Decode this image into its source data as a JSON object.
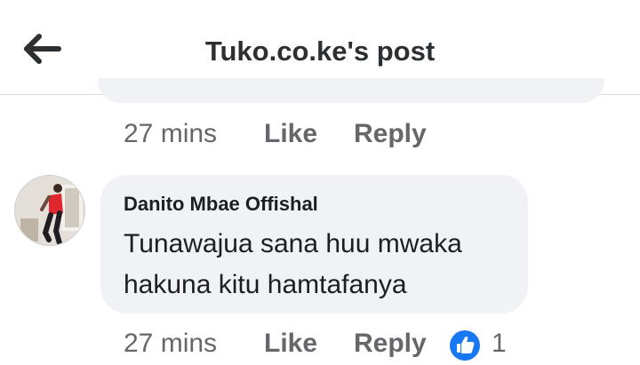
{
  "header": {
    "title": "Tuko.co.ke's post",
    "back_icon": "arrow-left-icon"
  },
  "comments": [
    {
      "time": "27 mins",
      "like_label": "Like",
      "reply_label": "Reply"
    },
    {
      "author": "Danito Mbae Offishal",
      "lines": [
        "Tunawajua sana huu mwaka",
        "hakuna kitu hamtafanya"
      ],
      "time": "27 mins",
      "like_label": "Like",
      "reply_label": "Reply",
      "reaction_icon": "thumbs-up-icon",
      "reaction_count": "1"
    }
  ],
  "colors": {
    "accent": "#1877f2",
    "bubble": "#f0f2f5",
    "meta_text": "#65676b"
  }
}
